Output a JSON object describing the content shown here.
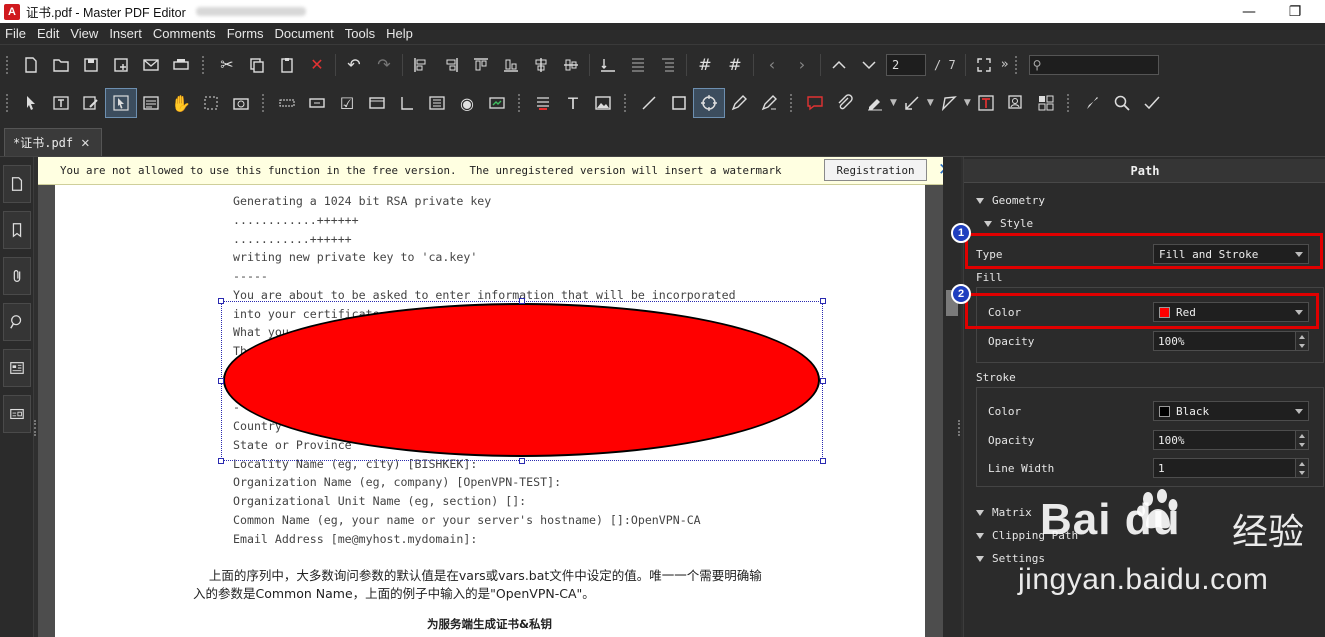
{
  "window": {
    "app_icon_label": "A",
    "title": "证书.pdf - Master PDF Editor",
    "minimize_glyph": "—",
    "restore_glyph": "❐"
  },
  "menu": [
    "File",
    "Edit",
    "View",
    "Insert",
    "Comments",
    "Forms",
    "Document",
    "Tools",
    "Help"
  ],
  "navigation": {
    "current_page": "2",
    "total_pages": "/ 7",
    "more_glyph": "»"
  },
  "tab": {
    "label": "*证书.pdf",
    "close_glyph": "✕"
  },
  "notice": {
    "text": "You are not allowed to use this function in the free version.  The unregistered version will insert a watermark",
    "button_label": "Registration",
    "close_glyph": "✕"
  },
  "document": {
    "code_lines": [
      "Generating a 1024 bit RSA private key",
      "............++++++",
      "...........++++++",
      "writing new private key to 'ca.key'",
      "-----",
      "You are about to be asked to enter information that will be incorporated",
      "into your certificate",
      "What you",
      "Th",
      "-",
      "Country",
      "State or Province",
      "Locality Name (eg, city) [BISHKEK]:",
      "Organization Name (eg, company) [OpenVPN-TEST]:",
      "Organizational Unit Name (eg, section) []:",
      "Common Name (eg, your name or your server's hostname) []:OpenVPN-CA",
      "Email Address [me@myhost.mydomain]:"
    ],
    "paragraph_line1": "    上面的序列中，大多数询问参数的默认值是在vars或vars.bat文件中设定的值。唯一一个需要明确输",
    "paragraph_line2": "入的参数是Common Name，上面的例子中输入的是\"OpenVPN-CA\"。",
    "heading": "为服务端生成证书&私钥"
  },
  "properties": {
    "header": "Path",
    "geometry_label": "Geometry",
    "style_label": "Style",
    "type_label": "Type",
    "type_value": "Fill and Stroke",
    "fill_label": "Fill",
    "fill_color_label": "Color",
    "fill_color_value": "Red",
    "fill_color_hex": "#ff0000",
    "fill_opacity_label": "Opacity",
    "fill_opacity_value": "100%",
    "stroke_label": "Stroke",
    "stroke_color_label": "Color",
    "stroke_color_value": "Black",
    "stroke_color_hex": "#000000",
    "stroke_opacity_label": "Opacity",
    "stroke_opacity_value": "100%",
    "line_width_label": "Line Width",
    "line_width_value": "1",
    "matrix_label": "Matrix",
    "clipping_label": "Clipping Path",
    "settings_label": "Settings"
  },
  "annotations": {
    "badge1": "1",
    "badge2": "2"
  },
  "watermark": {
    "brand": "Bai du",
    "cn": "经验",
    "url": "jingyan.baidu.com"
  },
  "colors": {
    "accent_red": "#e00000",
    "badge_blue": "#1f3fbf",
    "ellipse_fill": "#ff0000"
  }
}
